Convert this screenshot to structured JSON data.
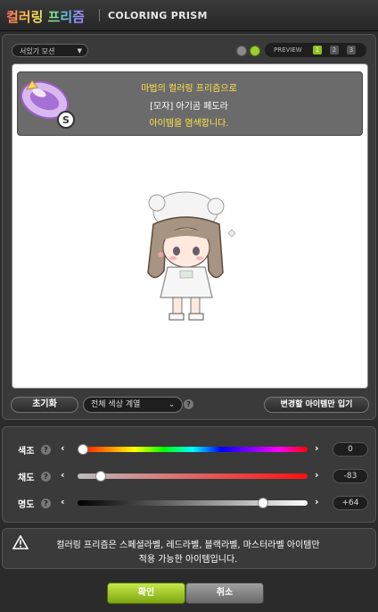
{
  "header": {
    "title_ko": "컬러링 프리즘",
    "title_en": "COLORING PRISM"
  },
  "preview": {
    "preset_select": "서있기 모션",
    "label": "PREVIEW",
    "buttons": [
      "1",
      "2",
      "3"
    ]
  },
  "info": {
    "line1": "마법의 컬러링 프리즘으로",
    "line2": "[모자] 아기곰 페도라",
    "line3": "아이템을 염색합니다."
  },
  "controls": {
    "reset_label": "초기화",
    "palette_select": "전체 색상 계열",
    "help": "?",
    "apply_changed_label": "변경할 아이템만 입기"
  },
  "sliders": [
    {
      "label": "색조",
      "value": "0",
      "position": 0.0
    },
    {
      "label": "채도",
      "value": "-83",
      "position": 0.08
    },
    {
      "label": "명도",
      "value": "+64",
      "position": 0.82
    }
  ],
  "notice": {
    "line1": "컬러링 프리즘은 스페셜라벨, 레드라벨, 블랙라벨, 마스터라벨 아이템만",
    "line2": "적용 가능한 아이템입니다."
  },
  "footer": {
    "confirm_label": "확인",
    "cancel_label": "취소"
  },
  "colors": {
    "accent_green": "#8fc21e",
    "info_yellow": "#ffe44a"
  }
}
